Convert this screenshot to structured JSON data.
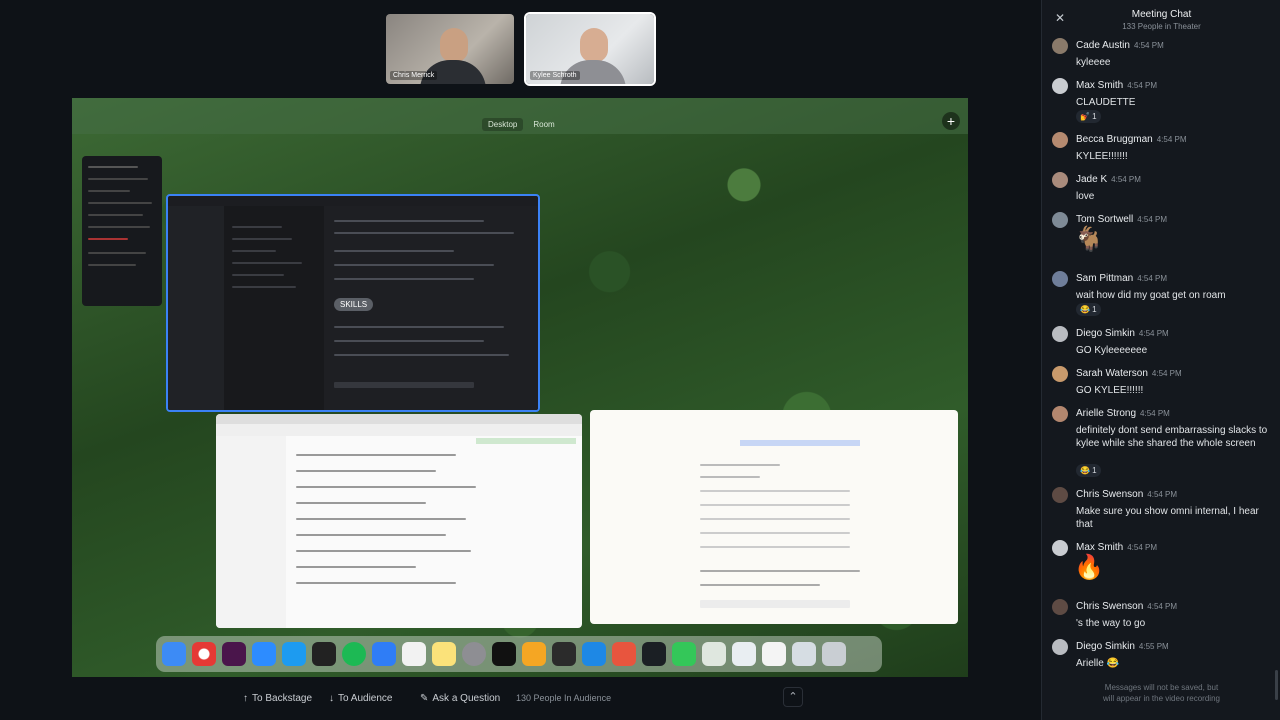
{
  "participants": [
    {
      "name": "Chris Merrick",
      "active": false
    },
    {
      "name": "Kylee Schroth",
      "active": true
    }
  ],
  "shared_screen": {
    "tabs": [
      "Desktop",
      "Room"
    ],
    "skills_label": "SKILLS"
  },
  "bottom_bar": {
    "backstage_label": "To Backstage",
    "audience_label": "To Audience",
    "question_label": "Ask a Question",
    "audience_count": "130 People In Audience"
  },
  "chat": {
    "title": "Meeting Chat",
    "subtitle": "133 People in Theater",
    "footer_line1": "Messages will not be saved, but",
    "footer_line2": "will appear in the video recording",
    "messages": [
      {
        "name": "Cade Austin",
        "time": "4:54 PM",
        "text": "kyleeee",
        "reaction": "",
        "emoji": ""
      },
      {
        "name": "Max Smith",
        "time": "4:54 PM",
        "text": "CLAUDETTE",
        "reaction": "💅 1",
        "emoji": ""
      },
      {
        "name": "Becca Bruggman",
        "time": "4:54 PM",
        "text": "KYLEE!!!!!!!",
        "reaction": "",
        "emoji": ""
      },
      {
        "name": "Jade K",
        "time": "4:54 PM",
        "text": "love",
        "reaction": "",
        "emoji": ""
      },
      {
        "name": "Tom Sortwell",
        "time": "4:54 PM",
        "text": "",
        "reaction": "",
        "emoji": "🐐"
      },
      {
        "name": "Sam Pittman",
        "time": "4:54 PM",
        "text": "wait how did my goat get on roam",
        "reaction": "😂 1",
        "emoji": ""
      },
      {
        "name": "Diego Simkin",
        "time": "4:54 PM",
        "text": "GO Kyleeeeeee",
        "reaction": "",
        "emoji": ""
      },
      {
        "name": "Sarah Waterson",
        "time": "4:54 PM",
        "text": "GO KYLEE!!!!!!",
        "reaction": "",
        "emoji": ""
      },
      {
        "name": "Arielle Strong",
        "time": "4:54 PM",
        "text": "definitely dont send embarrassing slacks to kylee while she shared the whole screen",
        "reaction": "😂 1",
        "emoji": ""
      },
      {
        "name": "Chris Swenson",
        "time": "4:54 PM",
        "text": "Make sure you show omni internal, I hear that",
        "reaction": "",
        "emoji": ""
      },
      {
        "name": "Max Smith",
        "time": "4:54 PM",
        "text": "",
        "reaction": "",
        "emoji": "🔥"
      },
      {
        "name": "Chris Swenson",
        "time": "4:54 PM",
        "text": "'s the way to go",
        "reaction": "",
        "emoji": ""
      },
      {
        "name": "Diego Simkin",
        "time": "4:55 PM",
        "text": "Arielle 😂",
        "reaction": "",
        "emoji": ""
      }
    ]
  },
  "colors": {
    "accent_blue": "#3b82f6",
    "chat_bg": "#14181e",
    "stage_bg": "#0e1217"
  }
}
